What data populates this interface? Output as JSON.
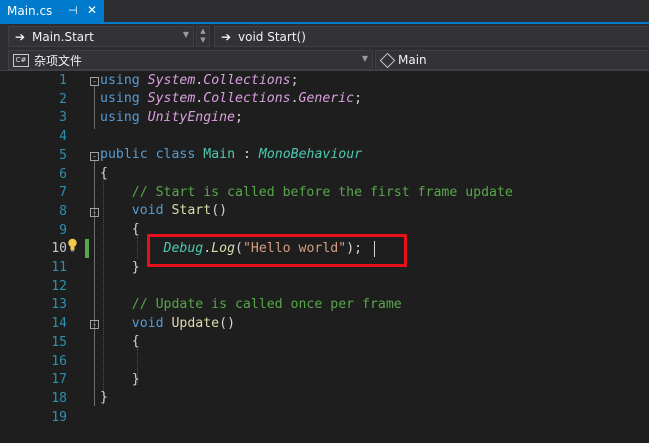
{
  "tab": {
    "title": "Main.cs",
    "pin_glyph": "⊣",
    "close_glyph": "✕"
  },
  "nav": {
    "class_combo": "Main.Start",
    "member_combo": "void Start()",
    "project_combo": "杂项文件",
    "project_icon_text": "C#",
    "context_combo": "Main"
  },
  "colors": {
    "accent": "#007acc",
    "keyword": "#569cd6",
    "type": "#4ec9b0",
    "comment": "#57a64a",
    "string": "#d69d85",
    "highlight": "#e8101a"
  },
  "line_numbers": [
    "1",
    "2",
    "3",
    "4",
    "5",
    "6",
    "7",
    "8",
    "9",
    "10",
    "11",
    "12",
    "13",
    "14",
    "15",
    "16",
    "17",
    "18",
    "19"
  ],
  "active_line": "10",
  "code": {
    "l1_kw": "using",
    "l1_a": "System",
    "l1_dot": ".",
    "l1_b": "Collections",
    "l1_end": ";",
    "l2_kw": "using",
    "l2_a": "System",
    "l2_dot1": ".",
    "l2_b": "Collections",
    "l2_dot2": ".",
    "l2_c": "Generic",
    "l2_end": ";",
    "l3_kw": "using",
    "l3_a": "UnityEngine",
    "l3_end": ";",
    "l5_kw1": "public",
    "l5_kw2": "class",
    "l5_name": "Main",
    "l5_colon": ":",
    "l5_base": "MonoBehaviour",
    "l6": "{",
    "l7": "// Start is called before the first frame update",
    "l8_kw": "void",
    "l8_name": "Start",
    "l8_paren": "()",
    "l9": "{",
    "l10_cls": "Debug",
    "l10_dot": ".",
    "l10_mt": "Log",
    "l10_open": "(",
    "l10_str": "\"Hello world\"",
    "l10_close": ");",
    "l11": "}",
    "l13": "// Update is called once per frame",
    "l14_kw": "void",
    "l14_name": "Update",
    "l14_paren": "()",
    "l15": "{",
    "l17": "}",
    "l18": "}"
  }
}
